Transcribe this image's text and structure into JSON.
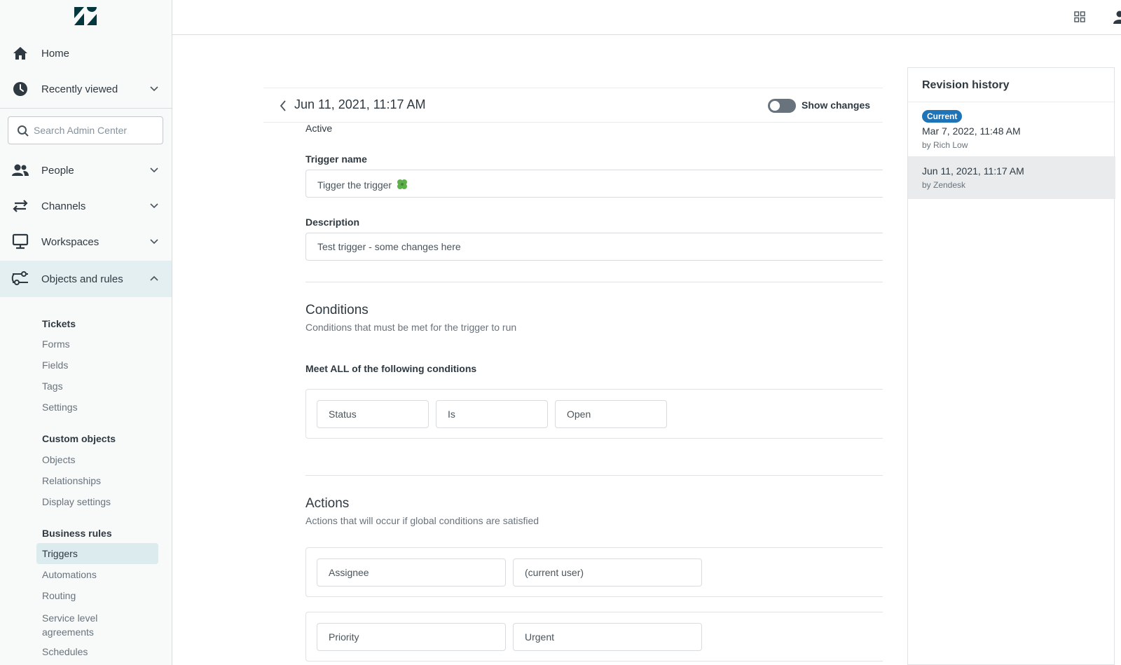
{
  "sidebar": {
    "nav": [
      {
        "label": "Home",
        "icon": "home-icon"
      },
      {
        "label": "Recently viewed",
        "icon": "clock-icon"
      },
      {
        "label": "People",
        "icon": "people-icon"
      },
      {
        "label": "Channels",
        "icon": "channels-icon"
      },
      {
        "label": "Workspaces",
        "icon": "workspaces-icon"
      },
      {
        "label": "Objects and rules",
        "icon": "objects-rules-icon"
      }
    ],
    "search_placeholder": "Search Admin Center",
    "tickets": {
      "heading": "Tickets",
      "items": [
        "Forms",
        "Fields",
        "Tags",
        "Settings"
      ]
    },
    "custom_objects": {
      "heading": "Custom objects",
      "items": [
        "Objects",
        "Relationships",
        "Display settings"
      ]
    },
    "business_rules": {
      "heading": "Business rules",
      "items": [
        "Triggers",
        "Automations",
        "Routing",
        "Service level agreements",
        "Schedules"
      ]
    }
  },
  "main": {
    "title": "Jun 11, 2021, 11:17 AM",
    "toggle_label": "Show changes",
    "status": "Active",
    "trigger_name_label": "Trigger name",
    "trigger_name_value": "Tigger the trigger",
    "description_label": "Description",
    "description_value": "Test trigger - some changes here",
    "conditions": {
      "heading": "Conditions",
      "subtitle": "Conditions that must be met for the trigger to run",
      "meet_all": "Meet ALL of the following conditions",
      "row": [
        "Status",
        "Is",
        "Open"
      ]
    },
    "actions": {
      "heading": "Actions",
      "subtitle": "Actions that will occur if global conditions are satisfied",
      "rows": [
        [
          "Assignee",
          "(current user)"
        ],
        [
          "Priority",
          "Urgent"
        ]
      ]
    }
  },
  "revision_history": {
    "title": "Revision history",
    "current_badge": "Current",
    "items": [
      {
        "date": "Mar 7, 2022, 11:48 AM",
        "by": "by Rich Low"
      },
      {
        "date": "Jun 11, 2021, 11:17 AM",
        "by": "by Zendesk"
      }
    ]
  },
  "colors": {
    "accent": "#1f73b7",
    "active_nav": "#e3eff1",
    "selected_item": "#dbebee"
  }
}
